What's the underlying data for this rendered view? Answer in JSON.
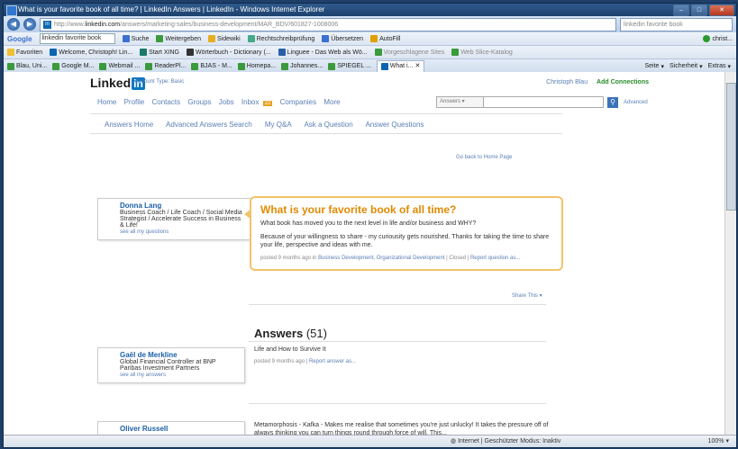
{
  "window": {
    "title": "What is your favorite book of all time? | LinkedIn Answers | LinkedIn - Windows Internet Explorer",
    "url_prefix": "http://www.",
    "url_host": "linkedin.com",
    "url_path": "/answers/marketing-sales/business-development/MAR_BDV/601827-1008006",
    "search_box": "linkedin favorite book"
  },
  "google_bar": {
    "logo": "Google",
    "query": "linkedin favorite book",
    "items": [
      "Suche",
      "Weitergeben",
      "Sidewiki",
      "Rechtschreibprüfung",
      "Übersetzen",
      "AutoFill",
      "christ..."
    ]
  },
  "favorites_bar": {
    "label": "Favoriten",
    "items": [
      "Welcome, Christoph! Lin...",
      "Start XING",
      "Wörterbuch - Dictionary (...",
      "Linguee - Das Web als Wö...",
      "Vorgeschlagene Sites",
      "Web Slice-Katalog"
    ]
  },
  "tabs": {
    "items": [
      "Blau, Uni...",
      "Google M...",
      "Webmail ...",
      "ReaderPl...",
      "BJAS - M...",
      "Homepa...",
      "Johannes...",
      "SPIEGEL ..."
    ],
    "active": "What i...",
    "commands": [
      "Seite",
      "Sicherheit",
      "Extras"
    ]
  },
  "linkedin": {
    "logo_text": "Linked",
    "logo_in": "in",
    "account_type": "Account Type: Basic",
    "user": "Christoph Blau",
    "add_connections": "Add Connections",
    "nav": [
      "Home",
      "Profile",
      "Contacts",
      "Groups",
      "Jobs",
      "Inbox",
      "Companies",
      "More"
    ],
    "inbox_badge": "22",
    "search_scope": "Answers",
    "advanced": "Advanced",
    "subnav": [
      "Answers Home",
      "Advanced Answers Search",
      "My Q&A",
      "Ask a Question",
      "Answer Questions"
    ],
    "go_back": "Go back to Home Page"
  },
  "question": {
    "title": "What is your favorite book of all time?",
    "body1": "What book has moved you to the next level in life and/or business and WHY?",
    "body2": "Because of your willingness to share - my curiousity gets nourished. Thanks for taking the time to share your life, perspective and ideas with me.",
    "meta_prefix": "posted 9 months ago in",
    "meta_links": "Business Development, Organizational Development",
    "meta_status": "| Closed |",
    "meta_report": "Report question as...",
    "share": "Share This"
  },
  "asker": {
    "name": "Donna Lang",
    "headline": "Business Coach / Life Coach / Social Media Strategist / Accelerate Success in Business & Life!",
    "see_all": "see all my questions"
  },
  "answers": {
    "heading": "Answers",
    "count": "(51)",
    "items": [
      {
        "name": "Gaël de Merkline",
        "headline": "Global Financial Controller at BNP Paribas Investment Partners",
        "see_all": "see all my answers",
        "text": "Life and How to Survive It",
        "meta": "posted 9 months ago |",
        "report": "Report answer as..."
      },
      {
        "name": "Oliver Russell",
        "text": "Metamorphosis - Kafka - Makes me realise that sometimes you're just unlucky! It takes the pressure off of always thinking you can turn things round through force of will. This..."
      }
    ]
  },
  "status_bar": {
    "zone": "Internet | Geschützter Modus: Inaktiv",
    "zoom": "100%"
  }
}
